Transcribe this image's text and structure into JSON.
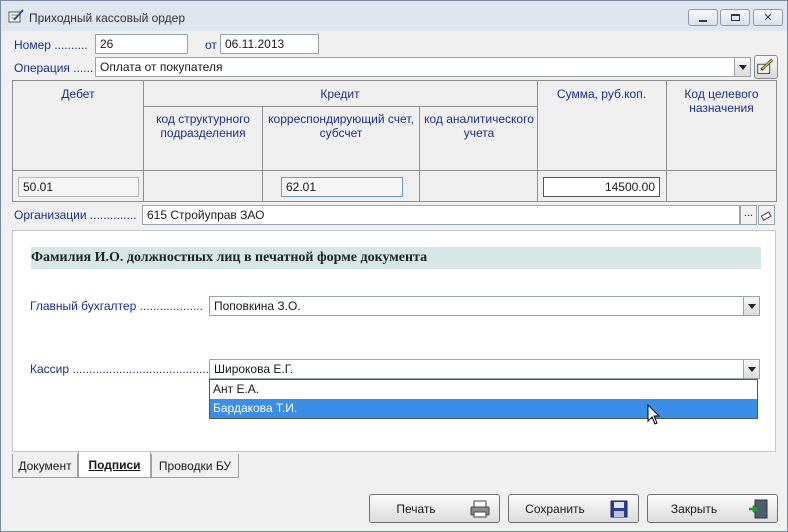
{
  "window": {
    "title": "Приходный кассовый ордер",
    "buttons": [
      "minimize",
      "maximize",
      "close"
    ]
  },
  "header": {
    "number_label": "Номер ..........",
    "number_value": "26",
    "date_label": "от",
    "date_value": "06.11.2013",
    "operation_label": "Операция ......",
    "operation_value": "Оплата от покупателя"
  },
  "grid": {
    "debit_header": "Дебет",
    "credit_header": "Кредит",
    "sub_headers": [
      "код структурного подразделения",
      "корреспондирующий счет, субсчет",
      "код аналитического учета"
    ],
    "sum_header": "Сумма, руб.коп.",
    "purpose_header": "Код целевого назначения",
    "debit_value": "50.01",
    "corr_account_value": "62.01",
    "sum_value": "14500.00"
  },
  "organization": {
    "label": "Организации ..............",
    "value": "615 Стройуправ ЗАО",
    "browse_label": "..."
  },
  "signatures": {
    "section_title": "Фамилия И.О. должностных лиц в печатной форме документа",
    "chief_label": "Главный бухгалтер ...................",
    "chief_value": "Поповкина З.О.",
    "cashier_label": "Кассир ..........................................",
    "cashier_value": "Широкова Е.Г.",
    "dropdown_options": [
      "Ант Е.А.",
      "Бардакова Т.И."
    ],
    "selected_option_index": 1
  },
  "tabs": [
    "Документ",
    "Подписи",
    "Проводки БУ"
  ],
  "active_tab": "Подписи",
  "buttons": {
    "print": "Печать",
    "save": "Сохранить",
    "close": "Закрыть"
  }
}
